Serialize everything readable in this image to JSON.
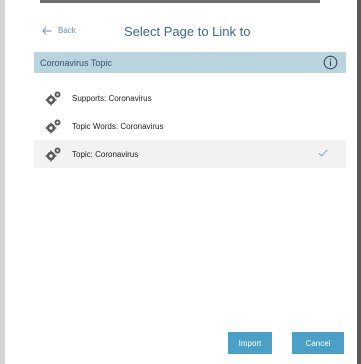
{
  "header": {
    "back_label": "Back",
    "title": "Select Page to Link to"
  },
  "section": {
    "label": "Coronavirus Topic",
    "info_icon": "info-icon"
  },
  "list": {
    "items": [
      {
        "label": "Supports: Coronavirus",
        "icon": "gears-icon",
        "selected": false
      },
      {
        "label": "Topic Words: Coronavirus",
        "icon": "gears-icon",
        "selected": false
      },
      {
        "label": "Topic: Coronavirus",
        "icon": "gears-icon",
        "selected": true
      }
    ]
  },
  "footer": {
    "import_label": "Import",
    "cancel_label": "Cancel"
  },
  "colors": {
    "accent": "#4aa0c6",
    "section_bg": "#b9d3df",
    "title": "#3b6a8a",
    "check": "#6aa8c8"
  }
}
